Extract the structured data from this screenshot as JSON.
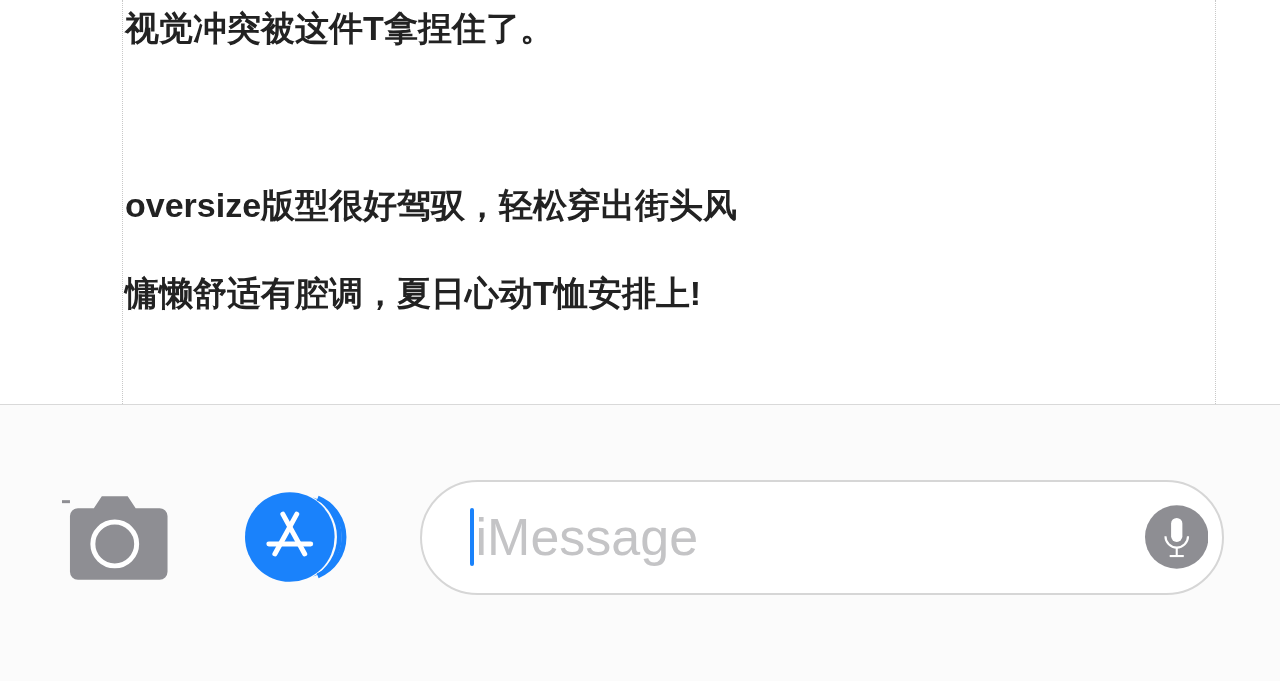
{
  "post": {
    "lines": [
      "视觉冲突被这件T拿捏住了。",
      "oversize版型很好驾驭，轻松穿出街头风",
      "慵懒舒适有腔调，夏日心动T恤安排上!"
    ]
  },
  "compose_bar": {
    "input": {
      "placeholder": "iMessage"
    }
  }
}
